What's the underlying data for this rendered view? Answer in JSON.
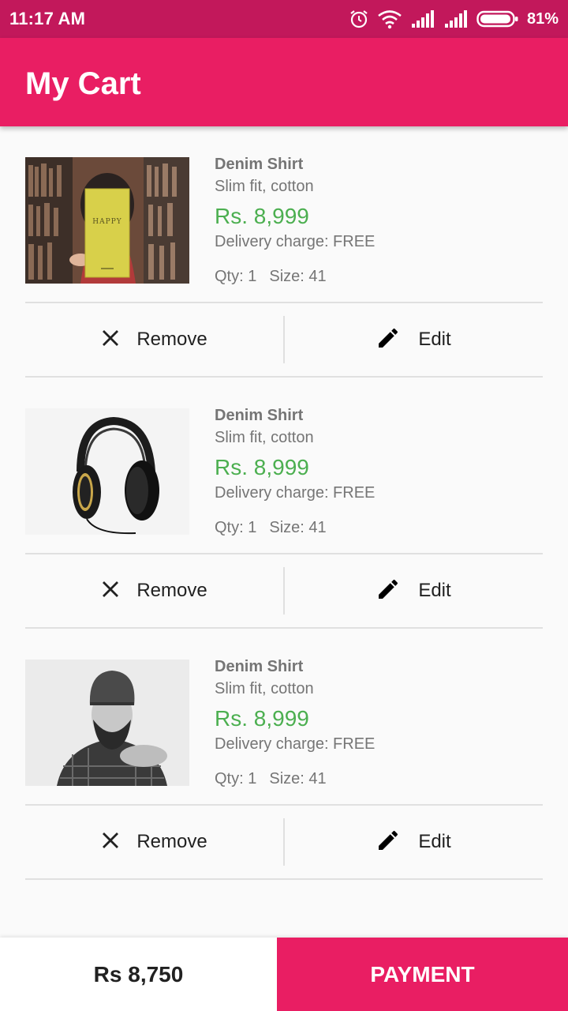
{
  "status_bar": {
    "time": "11:17 AM",
    "battery_percent": "81%",
    "icons": [
      "alarm-icon",
      "wifi-icon",
      "signal-icon",
      "signal-icon",
      "battery-icon"
    ]
  },
  "app_bar": {
    "title": "My Cart"
  },
  "colors": {
    "primary": "#e91e63",
    "primary_dark": "#c2185b",
    "price": "#4caf50"
  },
  "cart": {
    "items": [
      {
        "name": "Denim Shirt",
        "description": "Slim fit, cotton",
        "price": "Rs. 8,999",
        "delivery": "Delivery charge: FREE",
        "qty": "Qty: 1",
        "size": "Size: 41",
        "remove_label": "Remove",
        "edit_label": "Edit",
        "image": "book-photo"
      },
      {
        "name": "Denim Shirt",
        "description": "Slim fit, cotton",
        "price": "Rs. 8,999",
        "delivery": "Delivery charge: FREE",
        "qty": "Qty: 1",
        "size": "Size: 41",
        "remove_label": "Remove",
        "edit_label": "Edit",
        "image": "headphones-photo"
      },
      {
        "name": "Denim Shirt",
        "description": "Slim fit, cotton",
        "price": "Rs. 8,999",
        "delivery": "Delivery charge: FREE",
        "qty": "Qty: 1",
        "size": "Size: 41",
        "remove_label": "Remove",
        "edit_label": "Edit",
        "image": "man-photo"
      }
    ]
  },
  "footer": {
    "total": "Rs 8,750",
    "payment_label": "PAYMENT"
  }
}
